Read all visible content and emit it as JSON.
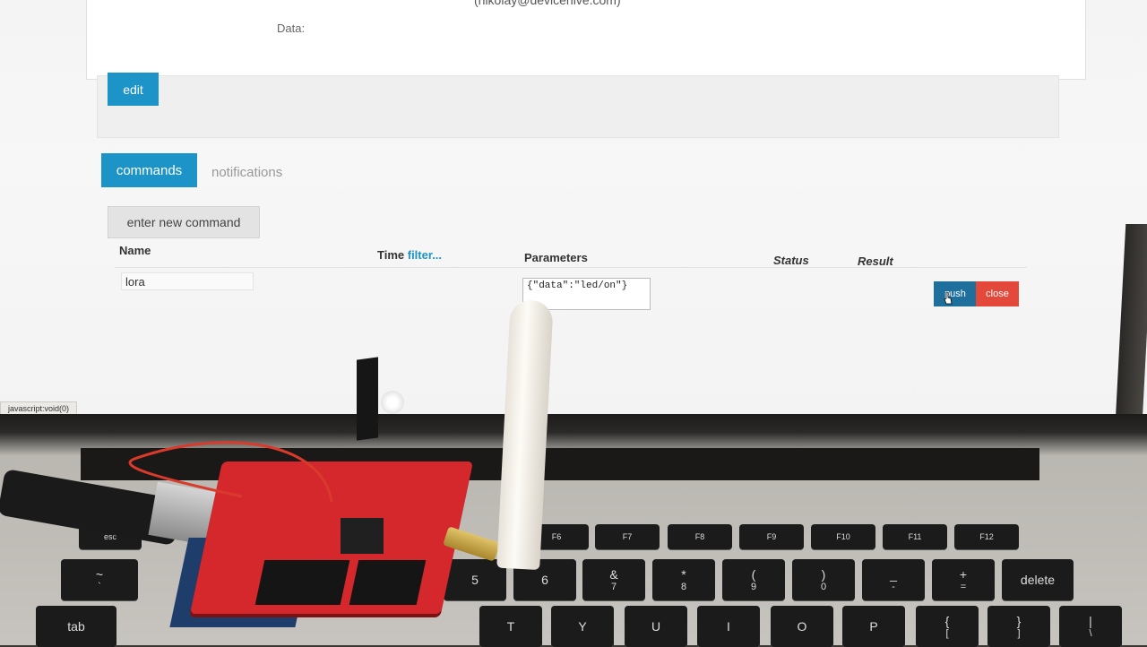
{
  "page": {
    "email_fragment": "(nikolay@devicehive.com)",
    "data_label": "Data:",
    "edit_label": "edit"
  },
  "tabs": {
    "commands": "commands",
    "notifications": "notifications"
  },
  "actions": {
    "new_command": "enter new command"
  },
  "table": {
    "headers": {
      "name": "Name",
      "time": "Time",
      "filter": "filter...",
      "parameters": "Parameters",
      "status": "Status",
      "result": "Result"
    },
    "row": {
      "name": "lora",
      "parameters": "{\"data\":\"led/on\"}",
      "push_label": "push",
      "close_label": "close"
    }
  },
  "statusbar": "javascript:void(0)",
  "keyboard": {
    "fkeys": [
      "esc",
      "F6",
      "F7",
      "F8",
      "F9",
      "F10",
      "F11",
      "F12"
    ],
    "numrow": [
      "~",
      "5",
      "6",
      "&",
      "*",
      "(",
      ")",
      "_",
      "+",
      "delete"
    ],
    "numrow_lower": [
      "`",
      "",
      "",
      "7",
      "8",
      "9",
      "0",
      "-",
      "=",
      ""
    ],
    "letters": [
      "tab",
      "T",
      "Y",
      "U",
      "I",
      "O",
      "P",
      "{",
      "}",
      "|"
    ],
    "letters_lower": [
      "",
      "",
      "",
      "",
      "",
      "",
      "",
      "[",
      "]",
      "\\"
    ]
  },
  "colors": {
    "primary": "#1d94c8",
    "danger": "#e4483a",
    "board": "#d4282c"
  }
}
